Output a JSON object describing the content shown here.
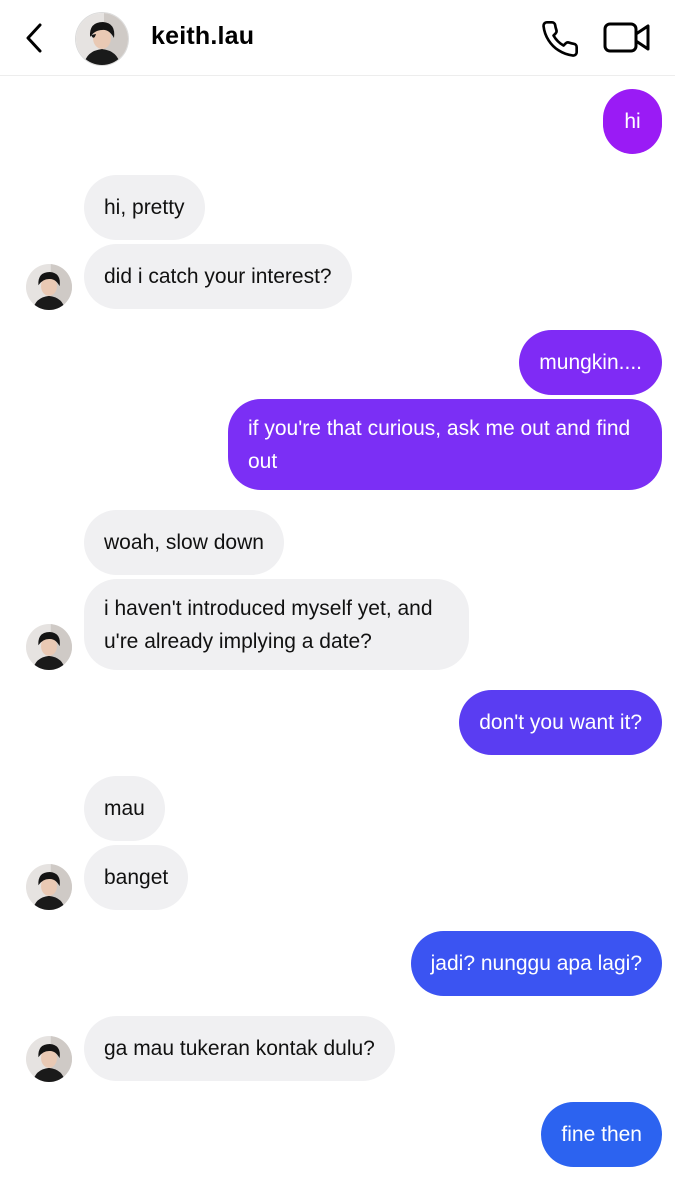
{
  "header": {
    "username": "keith.lau",
    "icons": [
      "back-chevron-icon",
      "avatar",
      "phone-icon",
      "video-camera-icon"
    ]
  },
  "messages": [
    {
      "from": "me",
      "text": "hi",
      "color": "#9a1bf5"
    },
    {
      "from": "them",
      "text": "hi, pretty"
    },
    {
      "from": "them",
      "text": "did i catch your interest?"
    },
    {
      "from": "me",
      "text": "mungkin....",
      "color": "#7f2bf5"
    },
    {
      "from": "me",
      "text": "if you're that curious, ask me out and find out",
      "color": "#7b2ff5"
    },
    {
      "from": "them",
      "text": "woah, slow down"
    },
    {
      "from": "them",
      "text": "i haven't introduced myself yet, and u're already implying a date?"
    },
    {
      "from": "me",
      "text": "don't you want it?",
      "color": "#5a3df2"
    },
    {
      "from": "them",
      "text": "mau"
    },
    {
      "from": "them",
      "text": "banget"
    },
    {
      "from": "me",
      "text": "jadi? nunggu apa lagi?",
      "color": "#3b54f2"
    },
    {
      "from": "them",
      "text": "ga mau tukeran kontak dulu?"
    },
    {
      "from": "me",
      "text": "fine then",
      "color": "#2c63f0"
    }
  ],
  "colors": {
    "incoming_bubble": "#f0f0f2",
    "incoming_text": "#111111",
    "outgoing_text": "#ffffff"
  }
}
